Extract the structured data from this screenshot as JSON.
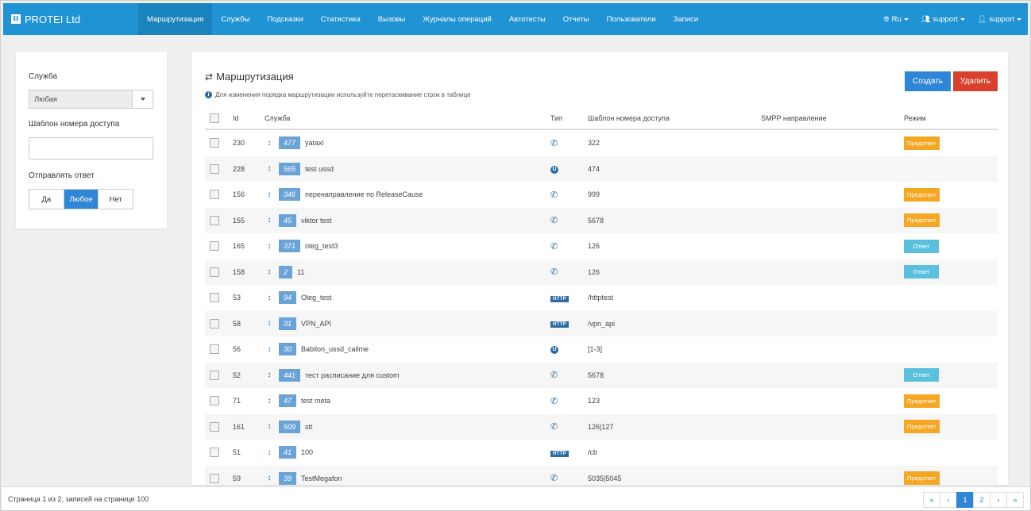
{
  "app": {
    "brand": "PROTEI Ltd",
    "brand_logo": "π"
  },
  "nav": {
    "items": [
      {
        "label": "Маршрутизация",
        "active": true
      },
      {
        "label": "Службы"
      },
      {
        "label": "Подсказки"
      },
      {
        "label": "Статистика"
      },
      {
        "label": "Вызовы"
      },
      {
        "label": "Журналы операций"
      },
      {
        "label": "Автотесты"
      },
      {
        "label": "Отчеты"
      },
      {
        "label": "Пользователи"
      },
      {
        "label": "Записи"
      }
    ],
    "right": {
      "language": "Ru",
      "user_group": "support",
      "user": "support"
    }
  },
  "filters": {
    "service_label": "Служба",
    "service_value": "Любая",
    "template_label": "Шаблон номера доступа",
    "template_value": "",
    "reply_label": "Отправлять ответ",
    "reply_options": [
      "Да",
      "Любое",
      "Нет"
    ],
    "reply_selected": "Любое"
  },
  "main": {
    "title": "Маршрутизация",
    "hint": "Для изменения порядка маршрутизации используйте перетаскивание строк в таблице",
    "create_label": "Создать",
    "delete_label": "Удалить",
    "columns": [
      "Id",
      "Служба",
      "Тип",
      "Шаблон номера доступа",
      "SMPP направление",
      "Режим"
    ],
    "rows": [
      {
        "id": "230",
        "svc_id": "477",
        "svc": "yataxi",
        "type": "phone",
        "tpl": "322",
        "smpp": "",
        "mode": "Предответ"
      },
      {
        "id": "228",
        "svc_id": "565",
        "svc": "test ussd",
        "type": "ussd",
        "tpl": "474",
        "smpp": "",
        "mode": ""
      },
      {
        "id": "156",
        "svc_id": "346",
        "svc": "перенаправление по ReleaseCause",
        "type": "phone",
        "tpl": "999",
        "smpp": "",
        "mode": "Предответ"
      },
      {
        "id": "155",
        "svc_id": "45",
        "svc": "viktor test",
        "type": "phone",
        "tpl": "5678",
        "smpp": "",
        "mode": "Предответ"
      },
      {
        "id": "165",
        "svc_id": "371",
        "svc": "oleg_test3",
        "type": "phone",
        "tpl": "126",
        "smpp": "",
        "mode": "Ответ"
      },
      {
        "id": "158",
        "svc_id": "2",
        "svc": "11",
        "type": "phone",
        "tpl": "126",
        "smpp": "",
        "mode": "Ответ"
      },
      {
        "id": "53",
        "svc_id": "94",
        "svc": "Oleg_test",
        "type": "http",
        "tpl": "/httptest",
        "smpp": "",
        "mode": ""
      },
      {
        "id": "58",
        "svc_id": "31",
        "svc": "VPN_API",
        "type": "http",
        "tpl": "/vpn_api",
        "smpp": "",
        "mode": ""
      },
      {
        "id": "56",
        "svc_id": "30",
        "svc": "Babilon_ussd_callme",
        "type": "ussd",
        "tpl": "[1-3]",
        "smpp": "",
        "mode": ""
      },
      {
        "id": "52",
        "svc_id": "441",
        "svc": "тест расписание для custom",
        "type": "phone",
        "tpl": "5678",
        "smpp": "",
        "mode": "Ответ"
      },
      {
        "id": "71",
        "svc_id": "47",
        "svc": "test meta",
        "type": "phone",
        "tpl": "123",
        "smpp": "",
        "mode": "Предответ"
      },
      {
        "id": "161",
        "svc_id": "509",
        "svc": "stt",
        "type": "phone",
        "tpl": "126|127",
        "smpp": "",
        "mode": "Предответ"
      },
      {
        "id": "51",
        "svc_id": "41",
        "svc": "100",
        "type": "http",
        "tpl": "/cb",
        "smpp": "",
        "mode": ""
      },
      {
        "id": "59",
        "svc_id": "39",
        "svc": "TestMegafon",
        "type": "phone",
        "tpl": "5035|5045",
        "smpp": "",
        "mode": "Предответ"
      }
    ]
  },
  "footer": {
    "summary": "Страница 1 из 2, записей на странице 100",
    "pages": [
      "«",
      "‹",
      "1",
      "2",
      "›",
      "»"
    ],
    "current_page": "1"
  },
  "icons": {
    "type_http_label": "HTTP",
    "type_ussd_label": "U"
  },
  "colors": {
    "navbar": "#1f93d3",
    "primary": "#2f86d6",
    "danger": "#d9412c",
    "preanswer": "#f5a623",
    "answer": "#5bc0de"
  }
}
